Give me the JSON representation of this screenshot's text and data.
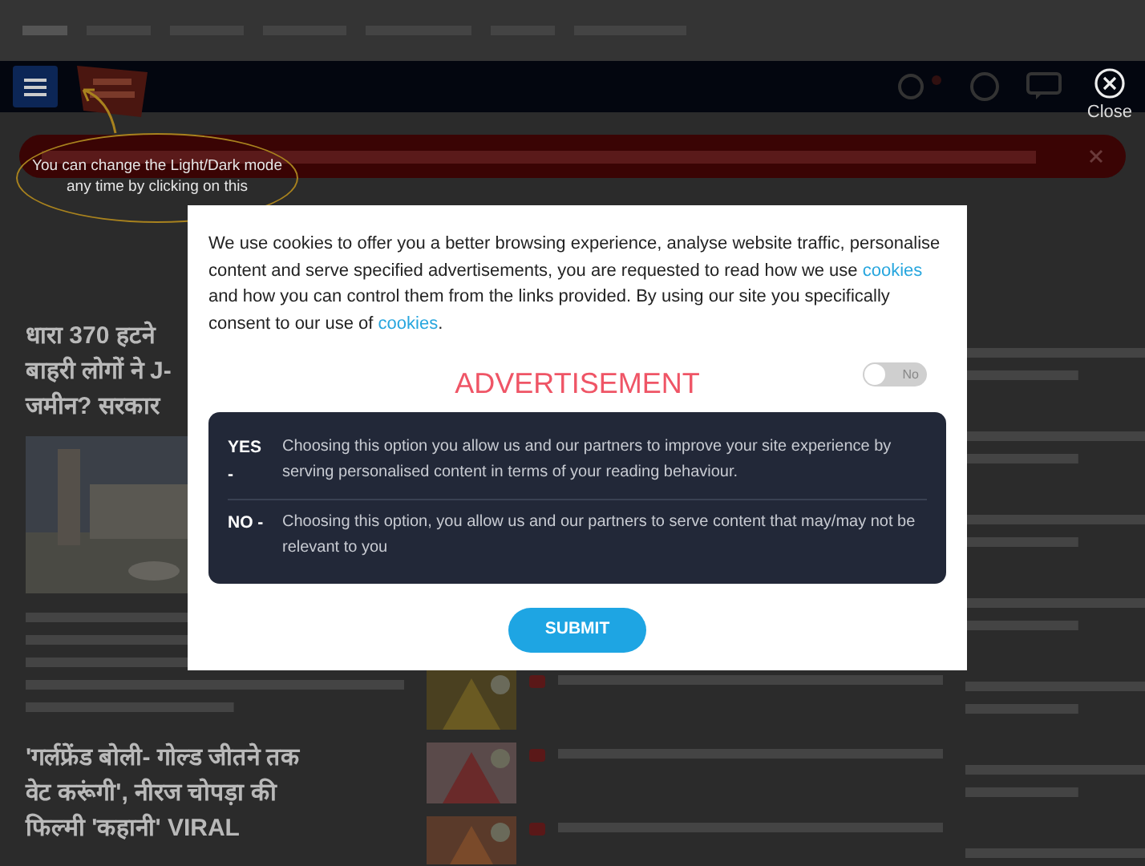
{
  "header": {
    "close_label": "Close",
    "tooltip": "You can change the Light/Dark mode any time by clicking on this"
  },
  "stories": [
    {
      "lines": [
        "धारा 370 हटने",
        "बाहरी लोगों ने J-",
        "जमीन? सरकार"
      ]
    },
    {
      "lines": [
        "'गर्लफ्रेंड बोली- गोल्ड जीतने तक",
        "वेट करूंगी', नीरज चोपड़ा की",
        "फिल्मी 'कहानी' VIRAL"
      ]
    }
  ],
  "cookie_dialog": {
    "message_parts": [
      {
        "text": "We use cookies to offer you a better browsing experience, analyse website traffic, personalise content and serve specified advertisements, you are requested to read how we use ",
        "link": false
      },
      {
        "text": "cookies",
        "link": true
      },
      {
        "text": " and how you can control them from the links provided. By using our site you specifically consent to our use of ",
        "link": false
      },
      {
        "text": "cookies",
        "link": true
      },
      {
        "text": ".",
        "link": false
      }
    ],
    "advertisement": {
      "title": "ADVERTISEMENT",
      "toggle_label": "No",
      "on": false
    },
    "options": [
      {
        "label": "YES -",
        "text": "Choosing this option you allow us and our partners to improve your site experience by serving personalised content in terms of your reading behaviour."
      },
      {
        "label": "NO -",
        "text": "Choosing this option, you allow us and our partners to serve content that may/may not be relevant to you"
      }
    ],
    "submit": "SUBMIT"
  }
}
